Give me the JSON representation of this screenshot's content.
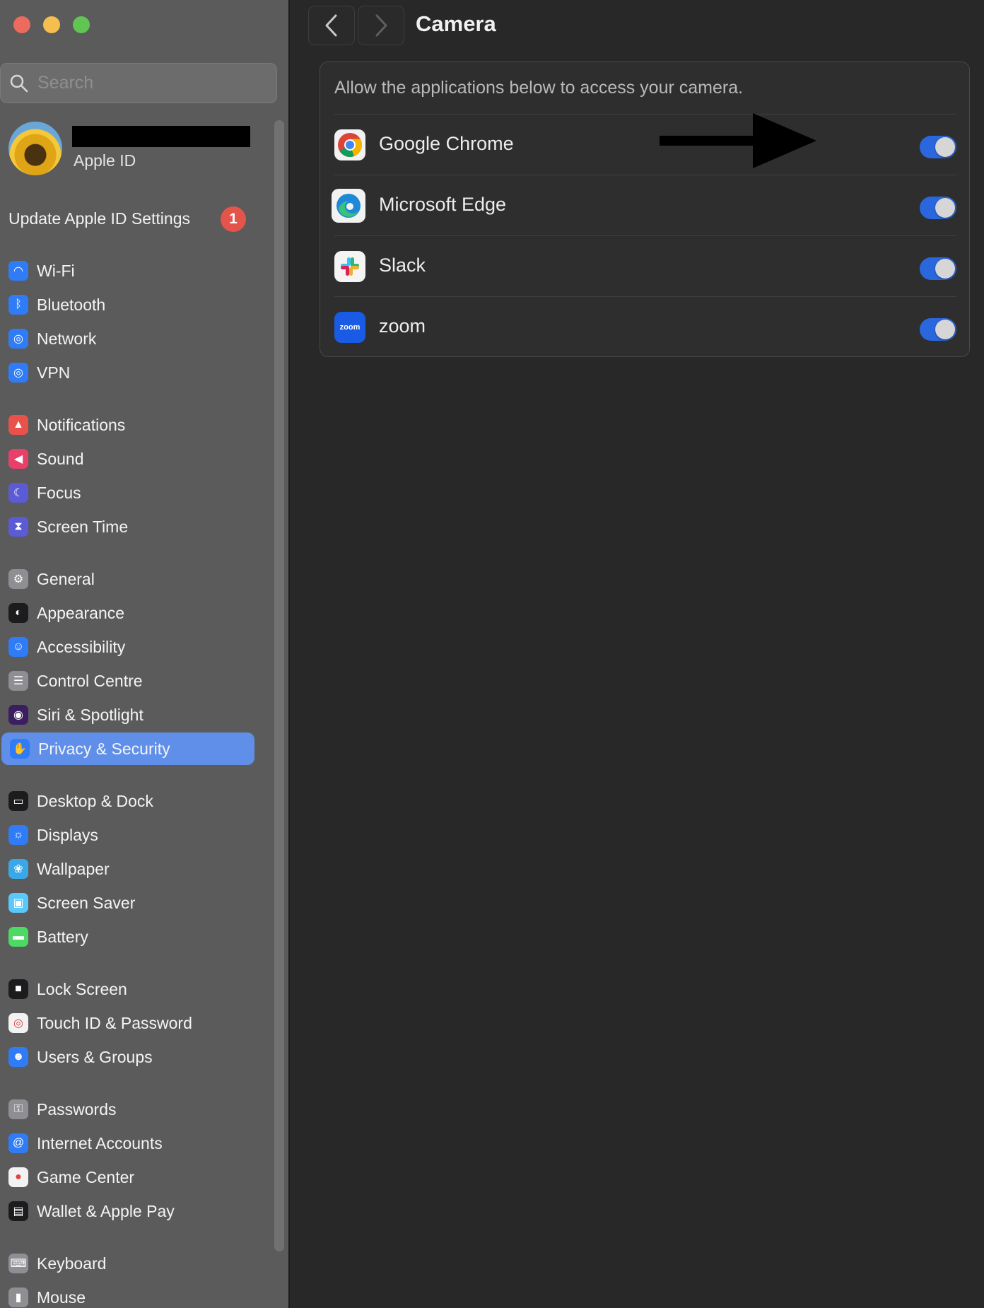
{
  "sidebar": {
    "search": {
      "placeholder": "Search"
    },
    "profile": {
      "subtitle": "Apple ID"
    },
    "update": {
      "label": "Update Apple ID Settings",
      "badge": "1"
    },
    "items": [
      {
        "label": "Wi-Fi",
        "icon": "wifi-icon",
        "color": "#2f7cf6"
      },
      {
        "label": "Bluetooth",
        "icon": "bluetooth-icon",
        "color": "#2f7cf6"
      },
      {
        "label": "Network",
        "icon": "globe-icon",
        "color": "#2f7cf6"
      },
      {
        "label": "VPN",
        "icon": "vpn-globe-icon",
        "color": "#2f7cf6"
      },
      {
        "label": "Notifications",
        "icon": "bell-icon",
        "color": "#e9524a"
      },
      {
        "label": "Sound",
        "icon": "speaker-icon",
        "color": "#e9406a"
      },
      {
        "label": "Focus",
        "icon": "moon-icon",
        "color": "#5b5bd6"
      },
      {
        "label": "Screen Time",
        "icon": "hourglass-icon",
        "color": "#5b5bd6"
      },
      {
        "label": "General",
        "icon": "gear-icon",
        "color": "#8e8e93"
      },
      {
        "label": "Appearance",
        "icon": "appearance-icon",
        "color": "#1c1c1e"
      },
      {
        "label": "Accessibility",
        "icon": "accessibility-icon",
        "color": "#2f7cf6"
      },
      {
        "label": "Control Centre",
        "icon": "control-centre-icon",
        "color": "#8e8e93"
      },
      {
        "label": "Siri & Spotlight",
        "icon": "siri-icon",
        "color": "#3a1e5f"
      },
      {
        "label": "Privacy & Security",
        "icon": "hand-icon",
        "color": "#2f7cf6",
        "selected": true
      },
      {
        "label": "Desktop & Dock",
        "icon": "dock-icon",
        "color": "#1c1c1e"
      },
      {
        "label": "Displays",
        "icon": "sun-icon",
        "color": "#2f7cf6"
      },
      {
        "label": "Wallpaper",
        "icon": "wallpaper-icon",
        "color": "#3aa8e8"
      },
      {
        "label": "Screen Saver",
        "icon": "screen-saver-icon",
        "color": "#5ac8fa"
      },
      {
        "label": "Battery",
        "icon": "battery-icon",
        "color": "#4cd964"
      },
      {
        "label": "Lock Screen",
        "icon": "lock-icon",
        "color": "#1c1c1e"
      },
      {
        "label": "Touch ID & Password",
        "icon": "fingerprint-icon",
        "color": "#f2f2f2"
      },
      {
        "label": "Users & Groups",
        "icon": "users-icon",
        "color": "#2f7cf6"
      },
      {
        "label": "Passwords",
        "icon": "key-icon",
        "color": "#8e8e93"
      },
      {
        "label": "Internet Accounts",
        "icon": "at-icon",
        "color": "#2f7cf6"
      },
      {
        "label": "Game Center",
        "icon": "game-center-icon",
        "color": "#f2f2f2"
      },
      {
        "label": "Wallet & Apple Pay",
        "icon": "wallet-icon",
        "color": "#1c1c1e"
      },
      {
        "label": "Keyboard",
        "icon": "keyboard-icon",
        "color": "#8e8e93"
      },
      {
        "label": "Mouse",
        "icon": "mouse-icon",
        "color": "#8e8e93"
      }
    ]
  },
  "main": {
    "title": "Camera",
    "description": "Allow the applications below to access your camera.",
    "apps": [
      {
        "name": "Google Chrome",
        "icon": "chrome-icon",
        "enabled": true
      },
      {
        "name": "Microsoft Edge",
        "icon": "edge-icon",
        "enabled": true
      },
      {
        "name": "Slack",
        "icon": "slack-icon",
        "enabled": true
      },
      {
        "name": "zoom",
        "icon": "zoom-icon",
        "icon_text": "zoom",
        "enabled": true
      }
    ]
  },
  "colors": {
    "accent": "#2a67dd",
    "selection": "#5f8fe8"
  }
}
